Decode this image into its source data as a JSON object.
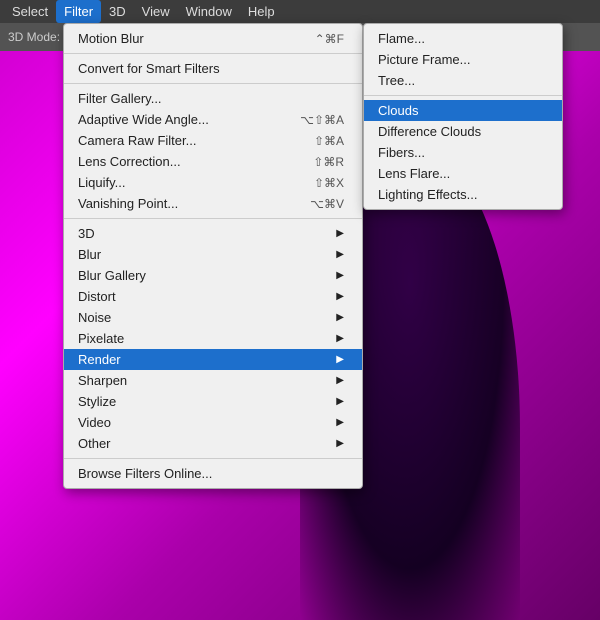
{
  "colors": {
    "menubar_bg": "#3c3c3c",
    "toolbar_bg": "#535353",
    "menu_bg": "#f0f0f0",
    "active_bg": "#1d6fcc",
    "separator": "#cccccc"
  },
  "menubar": {
    "items": [
      {
        "label": "Select",
        "active": false
      },
      {
        "label": "Filter",
        "active": true
      },
      {
        "label": "3D",
        "active": false
      },
      {
        "label": "View",
        "active": false
      },
      {
        "label": "Window",
        "active": false
      },
      {
        "label": "Help",
        "active": false
      }
    ]
  },
  "toolbar": {
    "mode_label": "3D Mode:",
    "icons": [
      "sphere-icon",
      "rotate-icon",
      "move-icon",
      "camera-icon"
    ]
  },
  "filter_menu": {
    "sections": [
      {
        "items": [
          {
            "label": "Motion Blur",
            "shortcut": "⌃⌘F",
            "has_submenu": false,
            "active": false,
            "disabled": false
          }
        ]
      },
      {
        "items": [
          {
            "label": "Convert for Smart Filters",
            "shortcut": "",
            "has_submenu": false,
            "active": false,
            "disabled": false
          }
        ]
      },
      {
        "items": [
          {
            "label": "Filter Gallery...",
            "shortcut": "",
            "has_submenu": false,
            "active": false,
            "disabled": false
          },
          {
            "label": "Adaptive Wide Angle...",
            "shortcut": "⌥⇧⌘A",
            "has_submenu": false,
            "active": false,
            "disabled": false
          },
          {
            "label": "Camera Raw Filter...",
            "shortcut": "⇧⌘A",
            "has_submenu": false,
            "active": false,
            "disabled": false
          },
          {
            "label": "Lens Correction...",
            "shortcut": "⇧⌘R",
            "has_submenu": false,
            "active": false,
            "disabled": false
          },
          {
            "label": "Liquify...",
            "shortcut": "⇧⌘X",
            "has_submenu": false,
            "active": false,
            "disabled": false
          },
          {
            "label": "Vanishing Point...",
            "shortcut": "⌥⌘V",
            "has_submenu": false,
            "active": false,
            "disabled": false
          }
        ]
      },
      {
        "items": [
          {
            "label": "3D",
            "shortcut": "",
            "has_submenu": true,
            "active": false,
            "disabled": false
          },
          {
            "label": "Blur",
            "shortcut": "",
            "has_submenu": true,
            "active": false,
            "disabled": false
          },
          {
            "label": "Blur Gallery",
            "shortcut": "",
            "has_submenu": true,
            "active": false,
            "disabled": false
          },
          {
            "label": "Distort",
            "shortcut": "",
            "has_submenu": true,
            "active": false,
            "disabled": false
          },
          {
            "label": "Noise",
            "shortcut": "",
            "has_submenu": true,
            "active": false,
            "disabled": false
          },
          {
            "label": "Pixelate",
            "shortcut": "",
            "has_submenu": true,
            "active": false,
            "disabled": false
          },
          {
            "label": "Render",
            "shortcut": "",
            "has_submenu": true,
            "active": true,
            "disabled": false
          },
          {
            "label": "Sharpen",
            "shortcut": "",
            "has_submenu": true,
            "active": false,
            "disabled": false
          },
          {
            "label": "Stylize",
            "shortcut": "",
            "has_submenu": true,
            "active": false,
            "disabled": false
          },
          {
            "label": "Video",
            "shortcut": "",
            "has_submenu": true,
            "active": false,
            "disabled": false
          },
          {
            "label": "Other",
            "shortcut": "",
            "has_submenu": true,
            "active": false,
            "disabled": false
          }
        ]
      },
      {
        "items": [
          {
            "label": "Browse Filters Online...",
            "shortcut": "",
            "has_submenu": false,
            "active": false,
            "disabled": false
          }
        ]
      }
    ]
  },
  "render_submenu": {
    "items": [
      {
        "label": "Flame...",
        "active": false
      },
      {
        "label": "Picture Frame...",
        "active": false
      },
      {
        "label": "Tree...",
        "active": false
      },
      {
        "label": "Clouds",
        "active": true
      },
      {
        "label": "Difference Clouds",
        "active": false
      },
      {
        "label": "Fibers...",
        "active": false
      },
      {
        "label": "Lens Flare...",
        "active": false
      },
      {
        "label": "Lighting Effects...",
        "active": false
      }
    ]
  }
}
